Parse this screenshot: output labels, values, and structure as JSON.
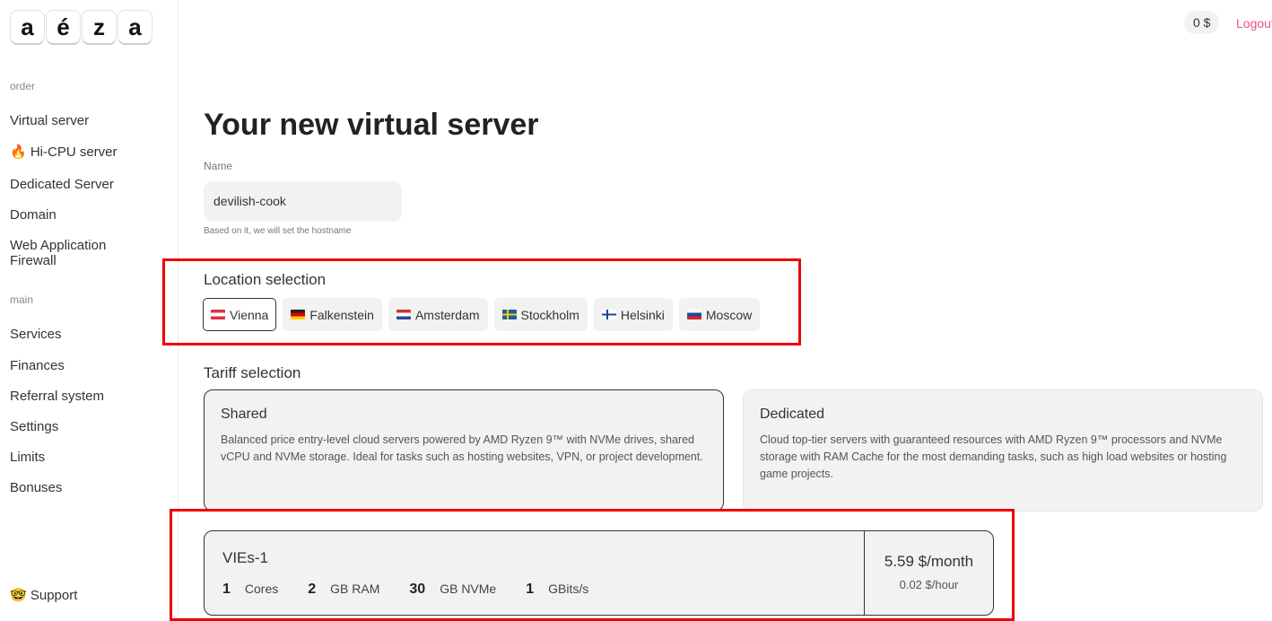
{
  "logo": [
    "a",
    "é",
    "z",
    "a"
  ],
  "sidebar": {
    "order_label": "order",
    "order_items": [
      "Virtual server",
      "🔥 Hi-CPU server",
      "Dedicated Server",
      "Domain",
      "Web Application Firewall"
    ],
    "main_label": "main",
    "main_items": [
      "Services",
      "Finances",
      "Referral system",
      "Settings",
      "Limits",
      "Bonuses"
    ],
    "support": "🤓 Support"
  },
  "header": {
    "balance": "0 $",
    "logout": "Logout"
  },
  "page": {
    "title": "Your new virtual server",
    "name_label": "Name",
    "name_value": "devilish-cook",
    "name_hint": "Based on it, we will set the hostname",
    "location_title": "Location selection",
    "locations": [
      {
        "name": "Vienna",
        "selected": true
      },
      {
        "name": "Falkenstein",
        "selected": false
      },
      {
        "name": "Amsterdam",
        "selected": false
      },
      {
        "name": "Stockholm",
        "selected": false
      },
      {
        "name": "Helsinki",
        "selected": false
      },
      {
        "name": "Moscow",
        "selected": false
      }
    ],
    "tariff_title": "Tariff selection",
    "tariffs": [
      {
        "name": "Shared",
        "desc": "Balanced price entry-level cloud servers powered by AMD Ryzen 9™ with NVMe drives, shared vCPU and NVMe storage. Ideal for tasks such as hosting websites, VPN, or project development."
      },
      {
        "name": "Dedicated",
        "desc": "Cloud top-tier servers with guaranteed resources with AMD Ryzen 9™ processors and NVMe storage with RAM Cache for the most demanding tasks, such as high load websites or hosting game projects."
      }
    ],
    "plan": {
      "name": "VIEs-1",
      "cores": "1",
      "cores_unit": "Cores",
      "ram": "2",
      "ram_unit": "GB RAM",
      "disk": "30",
      "disk_unit": "GB NVMe",
      "net": "1",
      "net_unit": "GBits/s",
      "price_month": "5.59 $/month",
      "price_hour": "0.02 $/hour"
    }
  }
}
